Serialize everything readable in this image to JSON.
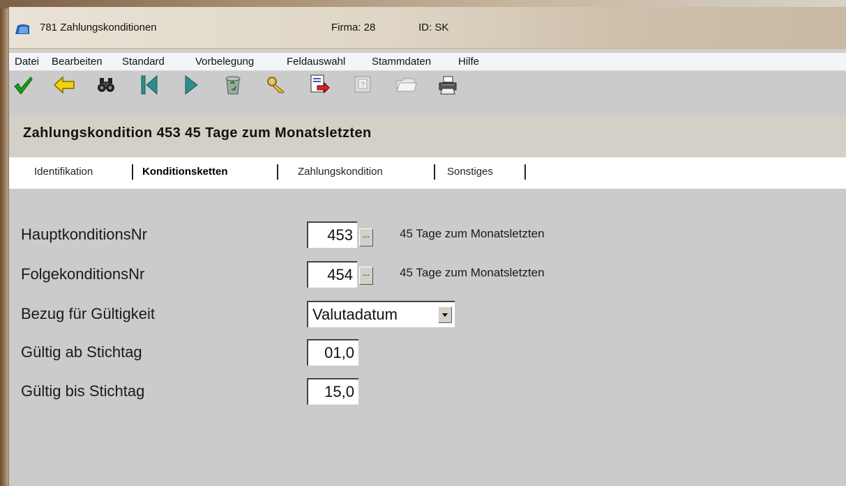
{
  "window": {
    "title": "781 Zahlungskonditionen",
    "firma": "Firma: 28",
    "id": "ID: SK"
  },
  "menu": [
    "Datei",
    "Bearbeiten",
    "Standard",
    "Vorbelegung",
    "Feldauswahl",
    "Stammdaten",
    "Hilfe"
  ],
  "toolbar": [
    "checkmark-icon",
    "back-arrow-icon",
    "binoculars-icon",
    "first-record-icon",
    "next-record-icon",
    "recycle-bin-icon",
    "key-icon",
    "export-icon",
    "help-icon",
    "folder-icon",
    "printer-icon"
  ],
  "form": {
    "title": "Zahlungskondition  453  45 Tage zum Monatsletzten"
  },
  "tabs": [
    "Identifikation",
    "Konditionsketten",
    "Zahlungskondition",
    "Sonstiges"
  ],
  "fields": {
    "haupt": {
      "label": "HauptkonditionsNr",
      "value": "453",
      "browse": "...",
      "desc": "45 Tage zum Monatsletzten"
    },
    "folge": {
      "label": "FolgekonditionsNr",
      "value": "454",
      "browse": "...",
      "desc": "45 Tage zum Monatsletzten"
    },
    "bezug": {
      "label": "Bezug für Gültigkeit",
      "value": "Valutadatum"
    },
    "ab": {
      "label": "Gültig ab Stichtag",
      "value": "01,0"
    },
    "bis": {
      "label": "Gültig bis Stichtag",
      "value": "15,0"
    }
  },
  "colors": {
    "accent": "#1a73c8",
    "checkmark": "#1a9c1a",
    "arrow": "#f2d400",
    "teal": "#2e8c8c"
  }
}
